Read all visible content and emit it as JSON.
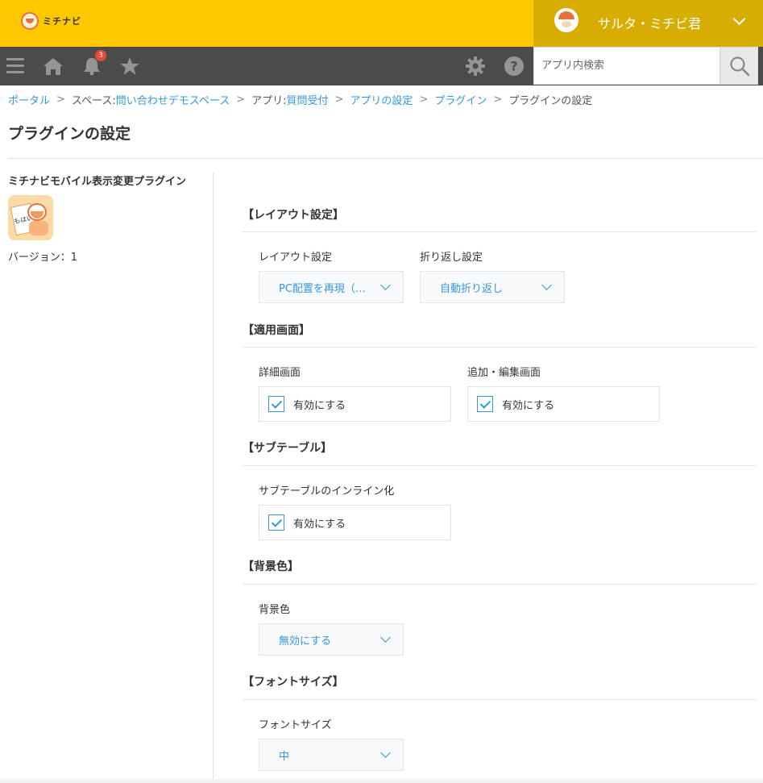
{
  "header": {
    "logo_text": "ミチナビ",
    "user_name": "サルタ・ミチビ君"
  },
  "nav": {
    "notification_count": "3",
    "search_placeholder": "アプリ内検索"
  },
  "breadcrumb": {
    "portal": "ポータル",
    "space_prefix": "スペース: ",
    "space": "問い合わせデモスペース",
    "app_prefix": "アプリ: ",
    "app": "質問受付",
    "app_settings": "アプリの設定",
    "plugins": "プラグイン",
    "current": "プラグインの設定",
    "separator": ">"
  },
  "page_title": "プラグインの設定",
  "plugin": {
    "name": "ミチナビモバイル表示変更プラグイン",
    "icon_card_text": "もはい",
    "version": "バージョン：1"
  },
  "sections": {
    "layout": {
      "title": "【レイアウト設定】",
      "layout_label": "レイアウト設定",
      "layout_value": "PC配置を再現（…",
      "wrap_label": "折り返し設定",
      "wrap_value": "自動折り返し"
    },
    "screens": {
      "title": "【適用画面】",
      "detail_label": "詳細画面",
      "detail_checkbox": "有効にする",
      "detail_checked": true,
      "edit_label": "追加・編集画面",
      "edit_checkbox": "有効にする",
      "edit_checked": true
    },
    "subtable": {
      "title": "【サブテーブル】",
      "inline_label": "サブテーブルのインライン化",
      "inline_checkbox": "有効にする",
      "inline_checked": true
    },
    "background": {
      "title": "【背景色】",
      "label": "背景色",
      "value": "無効にする"
    },
    "font": {
      "title": "【フォントサイズ】",
      "label": "フォントサイズ",
      "value": "中"
    }
  },
  "colors": {
    "header_yellow": "#ffc800",
    "user_area": "#d6ad00",
    "nav_dark": "#4b4b4b",
    "link_blue": "#3498db",
    "badge_red": "#e24a3b"
  },
  "icons": [
    "menu-icon",
    "home-icon",
    "bell-icon",
    "star-icon",
    "gear-icon",
    "help-icon",
    "search-icon",
    "chevron-down-icon",
    "check-icon"
  ]
}
